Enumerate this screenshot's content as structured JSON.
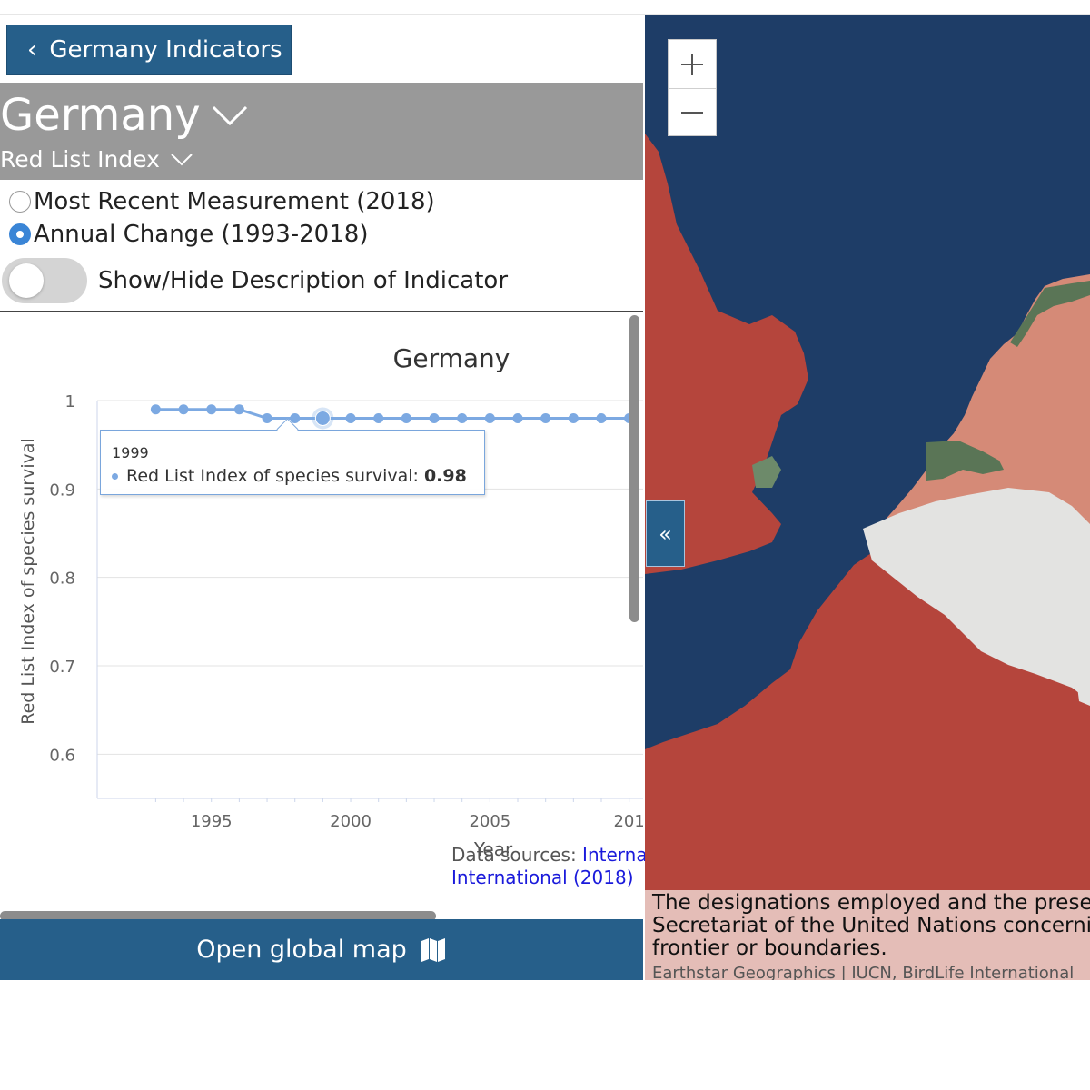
{
  "back_button": {
    "label": "Germany Indicators"
  },
  "country": {
    "name": "Germany"
  },
  "indicator": {
    "name": "Red List Index"
  },
  "options": {
    "most_recent": "Most Recent Measurement (2018)",
    "annual_change": "Annual Change (1993-2018)",
    "selected": "annual_change"
  },
  "toggle": {
    "label": "Show/Hide Description of Indicator",
    "on": false
  },
  "chart_data": {
    "type": "line",
    "title": "Germany",
    "xlabel": "Year",
    "ylabel": "Red List Index of species survival",
    "ylim": [
      0.55,
      1.0
    ],
    "y_ticks": [
      "1",
      "0.9",
      "0.8",
      "0.7",
      "0.6"
    ],
    "x_ticks": [
      "1995",
      "2000",
      "2005",
      "201"
    ],
    "series": [
      {
        "name": "Red List Index of species survival",
        "color": "#7ca9e2",
        "x": [
          1993,
          1994,
          1995,
          1996,
          1997,
          1998,
          1999,
          2000,
          2001,
          2002,
          2003,
          2004,
          2005,
          2006,
          2007,
          2008,
          2009,
          2010
        ],
        "values": [
          0.99,
          0.99,
          0.99,
          0.99,
          0.98,
          0.98,
          0.98,
          0.98,
          0.98,
          0.98,
          0.98,
          0.98,
          0.98,
          0.98,
          0.98,
          0.98,
          0.98,
          0.98
        ]
      }
    ],
    "highlight": {
      "year": "1999",
      "label": "Red List Index of species survival:",
      "value": "0.98"
    }
  },
  "data_sources": {
    "prefix": "Data sources:",
    "link_line1": "Internat",
    "link_line2": "International (2018)"
  },
  "open_map": {
    "label": "Open global map"
  },
  "map": {
    "zoom_in": "+",
    "zoom_out": "−",
    "collapse": "«",
    "disclaimer_lines": [
      "The designations employed and the presenta",
      "Secretariat of the United Nations concerning",
      "frontier or boundaries."
    ],
    "attribution": "Earthstar Geographics | IUCN, BirdLife International",
    "colors": {
      "sea": "#1e3d67",
      "red": "#b5453c",
      "salmon": "#d58a77",
      "white": "#e3e3e1",
      "green": "#5a7556"
    }
  }
}
